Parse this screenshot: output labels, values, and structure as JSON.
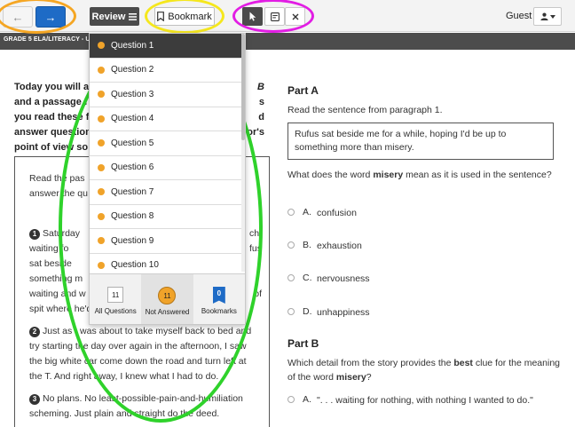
{
  "toolbar": {
    "back_icon": "←",
    "next_icon": "→",
    "review_label": "Review",
    "bookmark_label": "Bookmark",
    "guest_label": "Guest"
  },
  "title_bar": {
    "text": "GRADE 5 ELA/LITERACY - U"
  },
  "intro": [
    {
      "visible": "Today you will a",
      "tail": "B"
    },
    {
      "visible": "and a passage f",
      "tail": "s"
    },
    {
      "visible": "you read these f",
      "tail": "d"
    },
    {
      "visible": "answer question",
      "tail": "or's"
    },
    {
      "visible": "point of view so",
      "tail": ""
    }
  ],
  "passage": {
    "instr_1a": "Read the pas",
    "instr_2a": "answer the qu",
    "p1_num": "1",
    "p1_line1a": "Saturday",
    "p1_line1b": "ch,",
    "p1_line2a": "waiting fo",
    "p1_line2b": "fus",
    "p1_line3a": "sat beside",
    "p1_line4a": "something m",
    "p1_line5a": "waiting and w",
    "p1_line5b": "of",
    "p1_line6": "spit where he'd been sitting.",
    "p2_num": "2",
    "p2_text": "Just as I was about to take myself back to bed and try starting the day over again in the afternoon, I saw the big white car come down the road and turn left at the T. And right away, I knew what I had to do.",
    "p3_num": "3",
    "p3_text": "No plans. No least-possible-pain-and-humiliation scheming. Just plain and straight do the deed."
  },
  "dropdown": {
    "questions": [
      "Question 1",
      "Question 2",
      "Question 3",
      "Question 4",
      "Question 5",
      "Question 6",
      "Question 7",
      "Question 8",
      "Question 9",
      "Question 10"
    ],
    "active_index": 0,
    "filters": [
      {
        "count": "11",
        "label": "All Questions"
      },
      {
        "count": "11",
        "label": "Not Answered"
      },
      {
        "count": "0",
        "label": "Bookmarks"
      }
    ]
  },
  "part_a": {
    "title": "Part A",
    "instruction": "Read the sentence from paragraph 1.",
    "quote_line1": "Rufus sat beside me for a while, hoping I'd be up to",
    "quote_line2": "something more than misery.",
    "question_pre": "What does the word ",
    "question_bold": "misery",
    "question_post": " mean as it is used in the sentence?",
    "options": [
      {
        "letter": "A.",
        "text": "confusion"
      },
      {
        "letter": "B.",
        "text": "exhaustion"
      },
      {
        "letter": "C.",
        "text": "nervousness"
      },
      {
        "letter": "D.",
        "text": "unhappiness"
      }
    ]
  },
  "part_b": {
    "title": "Part B",
    "q_pre": "Which detail from the story provides the ",
    "q_bold": "best",
    "q_mid": " clue for the meaning of the word ",
    "q_bold2": "misery",
    "q_post": "?",
    "options": [
      {
        "letter": "A.",
        "text": "\". . . waiting for nothing, with nothing I wanted to do.\""
      }
    ]
  },
  "annotation_colors": {
    "orange": "#f5a623",
    "yellow": "#f5e71d",
    "magenta": "#e21de4",
    "green": "#2fd22b"
  },
  "accent_color": "#1e6bc6"
}
